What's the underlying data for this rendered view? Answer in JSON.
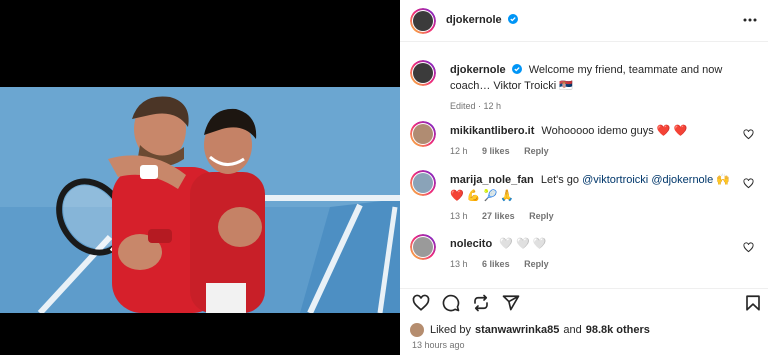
{
  "post": {
    "author": "djokernole",
    "caption_user": "djokernole",
    "caption_text": "Welcome my friend, teammate and now coach… Viktor Troicki 🇷🇸",
    "caption_meta": "Edited · 12 h"
  },
  "comments": [
    {
      "user": "mikikantlibero.it",
      "text": "Wohooooo idemo guys ❤️ ❤️",
      "time": "12 h",
      "likes": "9 likes",
      "reply": "Reply"
    },
    {
      "user": "marija_nole_fan",
      "text_before": "Let's go",
      "mention_1": "@viktortroicki",
      "mention_2": "@djokernole",
      "text_after": "🙌 ❤️ 💪 🎾 🙏",
      "time": "13 h",
      "likes": "27 likes",
      "reply": "Reply"
    },
    {
      "user": "nolecito",
      "text": "🤍 🤍 🤍",
      "time": "13 h",
      "likes": "6 likes",
      "reply": "Reply"
    }
  ],
  "likes": {
    "prefix": "Liked by",
    "user": "stanwawrinka85",
    "joiner": "and",
    "others": "98.8k others"
  },
  "timestamp": "13 hours ago",
  "icons": [
    "verified-icon",
    "more-icon",
    "heart-icon",
    "comment-icon",
    "share-icon",
    "send-icon",
    "bookmark-icon"
  ],
  "colors": {
    "verified": "#0095f6",
    "heart_red": "#ff3040",
    "mention": "#00376b",
    "muted": "#737373",
    "court_blue": "#5e9ccb",
    "jersey_red": "#d6202b"
  }
}
